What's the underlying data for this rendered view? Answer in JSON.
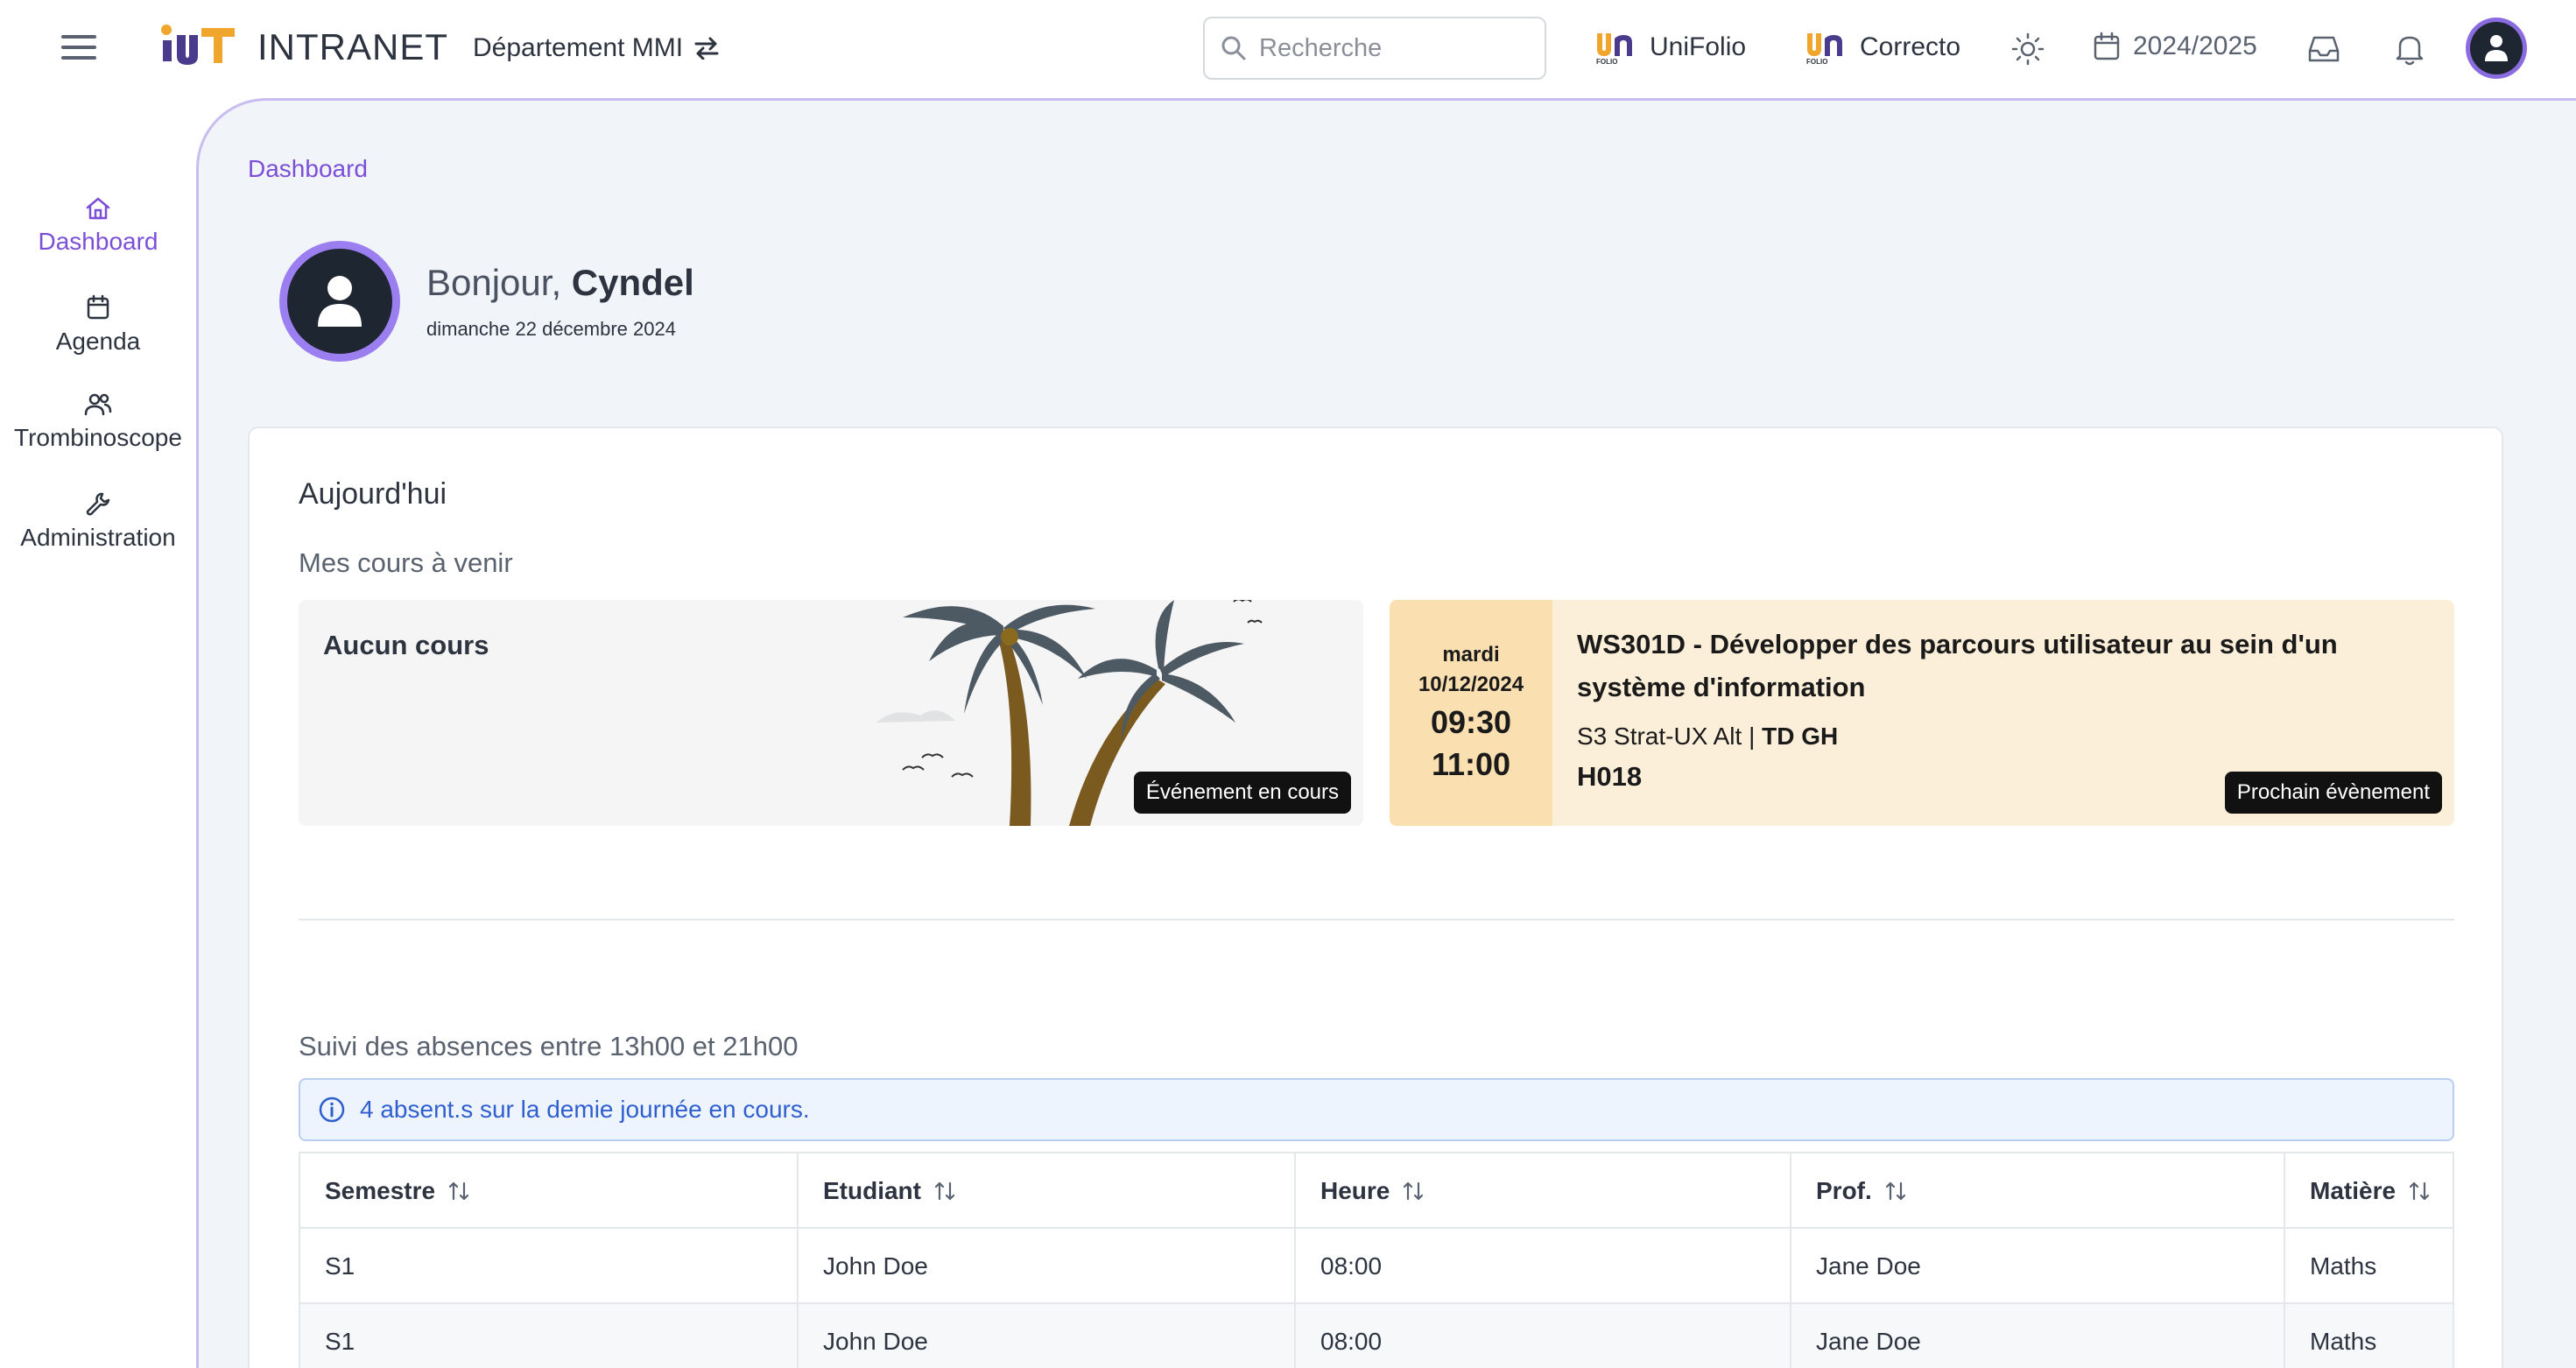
{
  "topbar": {
    "brand": "INTRANET",
    "department": "Département MMI",
    "search_placeholder": "Recherche",
    "apps": [
      {
        "label": "UniFolio",
        "icon": "unifolio-logo-icon"
      },
      {
        "label": "Correcto",
        "icon": "unifolio-logo-icon"
      }
    ],
    "year": "2024/2025"
  },
  "sidebar": {
    "items": [
      {
        "label": "Dashboard",
        "icon": "home-icon",
        "active": true
      },
      {
        "label": "Agenda",
        "icon": "calendar-icon",
        "active": false
      },
      {
        "label": "Trombinoscope",
        "icon": "users-icon",
        "active": false
      },
      {
        "label": "Administration",
        "icon": "wrench-icon",
        "active": false
      }
    ]
  },
  "main": {
    "breadcrumb": "Dashboard",
    "greeting_prefix": "Bonjour,",
    "user_name": "Cyndel",
    "date": "dimanche 22 décembre 2024"
  },
  "today": {
    "title": "Aujourd'hui",
    "subtitle": "Mes cours à venir",
    "current": {
      "title": "Aucun cours",
      "badge": "Événement en cours"
    },
    "next": {
      "day": "mardi",
      "date": "10/12/2024",
      "start": "09:30",
      "end": "11:00",
      "title": "WS301D - Développer des parcours utilisateur au sein d'un système d'information",
      "group_prefix": "S3 Strat-UX Alt |",
      "group": "TD GH",
      "room": "H018",
      "badge": "Prochain évènement"
    }
  },
  "absences": {
    "title": "Suivi des absences entre 13h00 et 21h00",
    "alert": "4 absent.s sur la demie journée en cours.",
    "columns": [
      "Semestre",
      "Etudiant",
      "Heure",
      "Prof.",
      "Matière"
    ],
    "rows": [
      [
        "S1",
        "John Doe",
        "08:00",
        "Jane Doe",
        "Maths"
      ],
      [
        "S1",
        "John Doe",
        "08:00",
        "Jane Doe",
        "Maths"
      ]
    ]
  },
  "colors": {
    "accent": "#7c4fd8",
    "next_event_bg": "#fcefd9",
    "next_event_date_bg": "#fadfb0",
    "alert_text": "#2f5fcf"
  }
}
